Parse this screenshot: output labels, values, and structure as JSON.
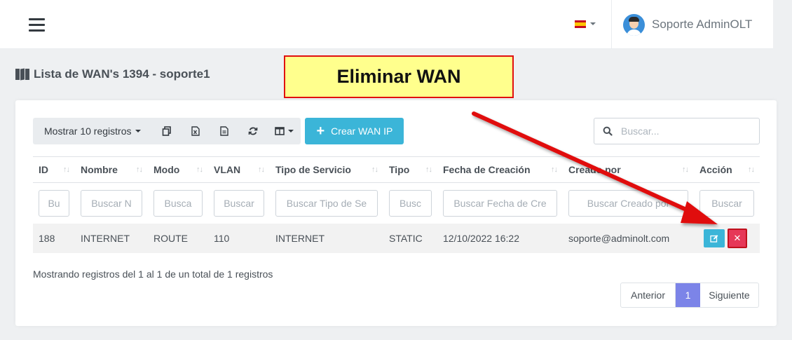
{
  "header": {
    "menu_icon": "hamburger-icon",
    "language_flag": "spain-flag-icon",
    "user_name": "Soporte AdminOLT"
  },
  "page": {
    "title": "Lista de WAN's 1394 - soporte1",
    "title_icon": "map-icon"
  },
  "toolbar": {
    "show_records": "Mostrar 10 registros",
    "copy_icon": "copy-icon",
    "excel_icon": "excel-icon",
    "pdf_icon": "file-icon",
    "refresh_icon": "refresh-icon",
    "columns_icon": "columns-icon",
    "create_label": "Crear WAN IP",
    "search_placeholder": "Buscar..."
  },
  "table": {
    "headers": [
      "ID",
      "Nombre",
      "Modo",
      "VLAN",
      "Tipo de Servicio",
      "Tipo",
      "Fecha de Creación",
      "Creado por",
      "Acción"
    ],
    "filters": [
      "Bu",
      "Buscar N",
      "Busca",
      "Buscar",
      "Buscar Tipo de Se",
      "Busc",
      "Buscar Fecha de Cre",
      "Buscar Creado por",
      "Buscar"
    ],
    "rows": [
      {
        "id": "188",
        "nombre": "INTERNET",
        "modo": "ROUTE",
        "vlan": "110",
        "tipo_servicio": "INTERNET",
        "tipo": "STATIC",
        "fecha": "12/10/2022 16:22",
        "creado_por": "soporte@adminolt.com"
      }
    ]
  },
  "footer": {
    "info": "Mostrando registros del 1 al 1 de un total de 1 registros",
    "prev": "Anterior",
    "page": "1",
    "next": "Siguiente"
  },
  "annotation": {
    "callout": "Eliminar WAN",
    "color": "#e01010"
  },
  "colors": {
    "accent": "#3bb5d8",
    "danger": "#e63858",
    "page_active": "#7c84e8"
  }
}
